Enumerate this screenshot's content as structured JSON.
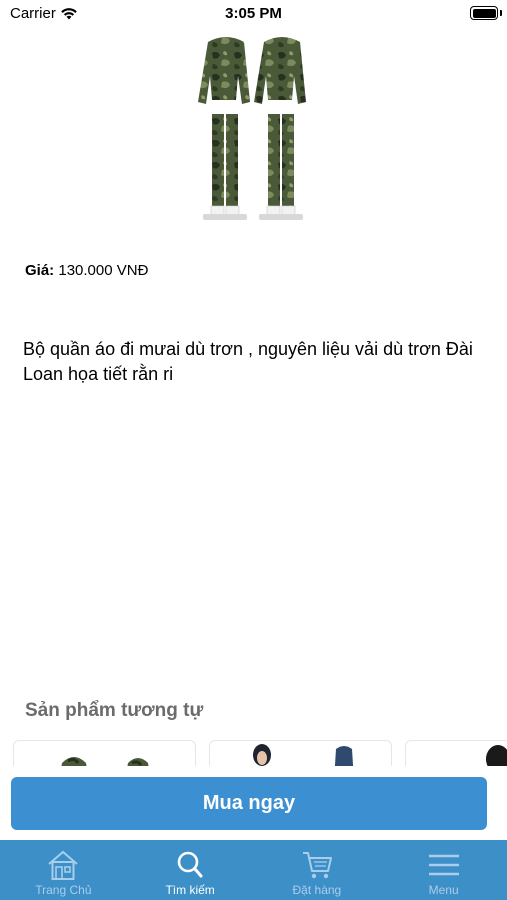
{
  "status_bar": {
    "carrier": "Carrier",
    "time": "3:05 PM"
  },
  "product": {
    "price_label": "Giá:",
    "price_value": "130.000 VNĐ",
    "description": "Bộ quần áo đi mưai dù trơn , nguyên liệu vải dù trơn Đài Loan họa tiết rằn ri"
  },
  "similar": {
    "title": "Sản phẩm tương tự"
  },
  "buy_button": {
    "label": "Mua ngay"
  },
  "tab_bar": {
    "active_color": "#ffffff",
    "inactive_color": "#a9cdeb",
    "background": "#3d8fc7",
    "tabs": [
      {
        "label": "Trang Chủ",
        "icon": "home-icon",
        "active": false
      },
      {
        "label": "Tìm kiếm",
        "icon": "search-icon",
        "active": true
      },
      {
        "label": "Đặt hàng",
        "icon": "cart-icon",
        "active": false
      },
      {
        "label": "Menu",
        "icon": "menu-icon",
        "active": false
      }
    ]
  },
  "colors": {
    "accent": "#3c8fd0"
  }
}
